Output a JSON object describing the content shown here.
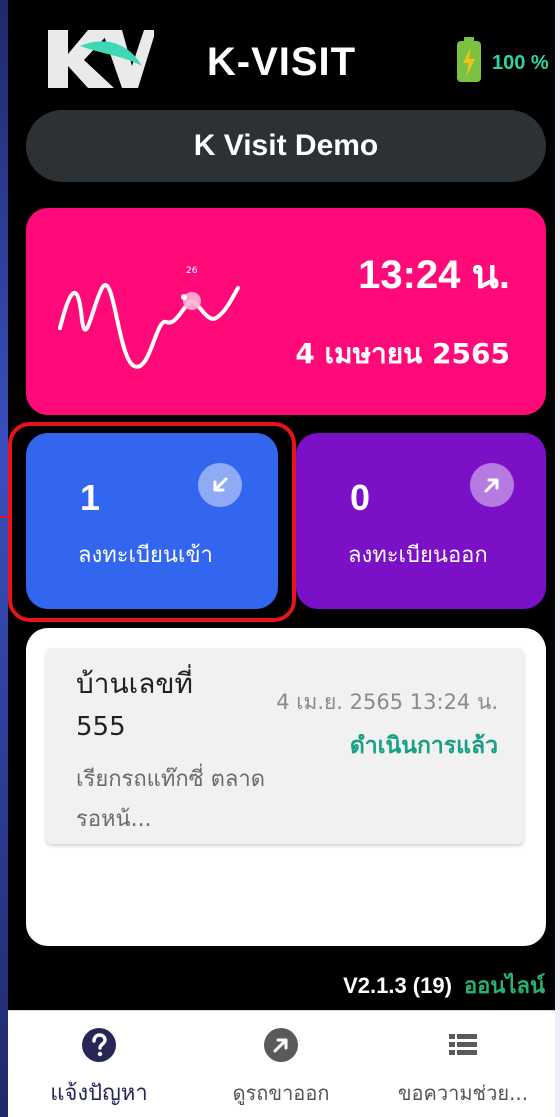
{
  "header": {
    "logo_text": "KV",
    "title": "K-VISIT",
    "battery_percent": "100 %",
    "battery_level": 1.0
  },
  "project": {
    "name": "K Visit Demo"
  },
  "clock": {
    "time": "13:24 น.",
    "date": "4 เมษายน 2565",
    "wave_marker_label": "26"
  },
  "stats": {
    "check_in": {
      "count": "1",
      "label": "ลงทะเบียนเข้า",
      "icon": "arrow-down-left-icon"
    },
    "check_out": {
      "count": "0",
      "label": "ลงทะเบียนออก",
      "icon": "arrow-up-right-icon"
    }
  },
  "visits": [
    {
      "house_label": "บ้านเลขที่",
      "house_number": "555",
      "description": "เรียกรถแท๊กซี่ ตลาด รอหน้...",
      "datetime": "4 เม.ย. 2565 13:24 น.",
      "status": "ดำเนินการแล้ว"
    }
  ],
  "footer": {
    "version": "V2.1.3 (19)",
    "connection": "ออนไลน์"
  },
  "nav": {
    "items": [
      {
        "label": "แจ้งปัญหา",
        "icon": "help-circle-icon",
        "active": true
      },
      {
        "label": "ดูรถขาออก",
        "icon": "arrow-up-right-circle-icon",
        "active": false
      },
      {
        "label": "ขอความช่วย...",
        "icon": "list-icon",
        "active": false
      }
    ]
  },
  "colors": {
    "clock_card": "#ff0a78",
    "check_in_card": "#3366ee",
    "check_out_card": "#7b10c7",
    "status_done": "#17a085",
    "online": "#2ab070",
    "highlight": "#e8141c"
  }
}
